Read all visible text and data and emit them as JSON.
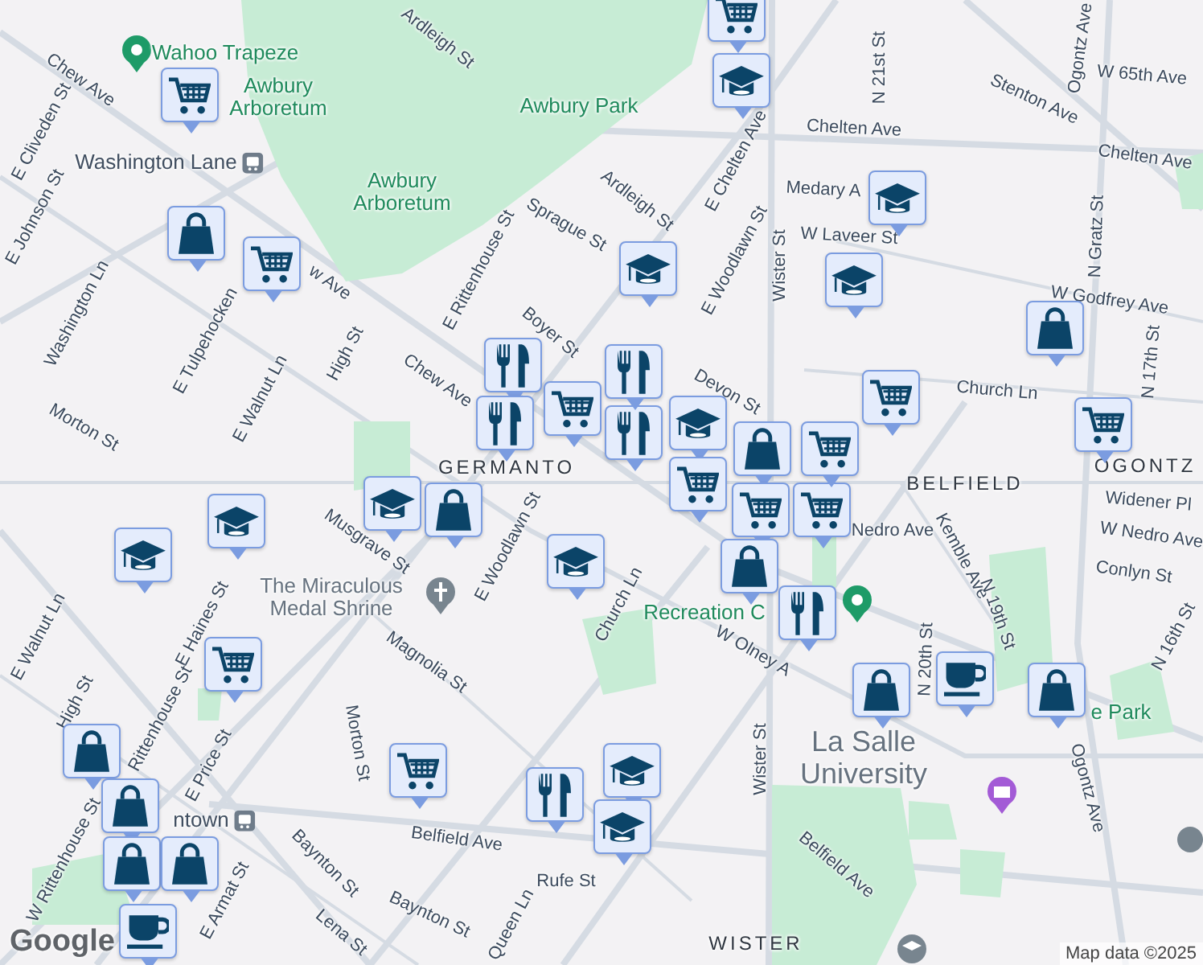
{
  "map": {
    "labels": [
      {
        "text": "Ardleigh St",
        "kind": "street"
      },
      {
        "text": "Chew Ave",
        "kind": "street"
      },
      {
        "text": "E Cliveden St",
        "kind": "street"
      },
      {
        "text": "E Johnson St",
        "kind": "street"
      },
      {
        "text": "Washington Ln",
        "kind": "street"
      },
      {
        "text": "E Tulpehocken",
        "kind": "street"
      },
      {
        "text": "w Ave",
        "kind": "street"
      },
      {
        "text": "E Walnut Ln",
        "kind": "street"
      },
      {
        "text": "High St",
        "kind": "street"
      },
      {
        "text": "Chew Ave",
        "kind": "street"
      },
      {
        "text": "E Rittenhouse St",
        "kind": "street"
      },
      {
        "text": "Boyer St",
        "kind": "street"
      },
      {
        "text": "Morton St",
        "kind": "street"
      },
      {
        "text": "Sprague St",
        "kind": "street"
      },
      {
        "text": "Ardleigh St",
        "kind": "street"
      },
      {
        "text": "E Chelten Ave",
        "kind": "street"
      },
      {
        "text": "E Woodlawn St",
        "kind": "street"
      },
      {
        "text": "Wister St",
        "kind": "street"
      },
      {
        "text": "N 21st St",
        "kind": "street"
      },
      {
        "text": "Chelten Ave",
        "kind": "street"
      },
      {
        "text": "Stenton Ave",
        "kind": "street"
      },
      {
        "text": "Ogontz Ave",
        "kind": "street"
      },
      {
        "text": "W 65th Ave",
        "kind": "street"
      },
      {
        "text": "Chelten Ave",
        "kind": "street"
      },
      {
        "text": "Medary A",
        "kind": "street"
      },
      {
        "text": "W Laveer St",
        "kind": "street"
      },
      {
        "text": "W Godfrey Ave",
        "kind": "street"
      },
      {
        "text": "N Gratz St",
        "kind": "street"
      },
      {
        "text": "N 17th St",
        "kind": "street"
      },
      {
        "text": "Devon St",
        "kind": "street"
      },
      {
        "text": "Church Ln",
        "kind": "street"
      },
      {
        "text": "Nedro Ave",
        "kind": "street"
      },
      {
        "text": "Widener Pl",
        "kind": "street"
      },
      {
        "text": "W Nedro Ave",
        "kind": "street"
      },
      {
        "text": "Conlyn St",
        "kind": "street"
      },
      {
        "text": "Kemble Ave",
        "kind": "street"
      },
      {
        "text": "N 19th St",
        "kind": "street"
      },
      {
        "text": "N 20th St",
        "kind": "street"
      },
      {
        "text": "N 16th St",
        "kind": "street"
      },
      {
        "text": "W Olney A",
        "kind": "street"
      },
      {
        "text": "Ogontz Ave",
        "kind": "street"
      },
      {
        "text": "Wister St",
        "kind": "street"
      },
      {
        "text": "Belfield Ave",
        "kind": "street"
      },
      {
        "text": "Musgrave St",
        "kind": "street"
      },
      {
        "text": "E Woodlawn St",
        "kind": "street"
      },
      {
        "text": "Church Ln",
        "kind": "street"
      },
      {
        "text": "High St",
        "kind": "street"
      },
      {
        "text": "E Haines St",
        "kind": "street"
      },
      {
        "text": "E Walnut Ln",
        "kind": "street"
      },
      {
        "text": "Magnolia St",
        "kind": "street"
      },
      {
        "text": "Morton St",
        "kind": "street"
      },
      {
        "text": "Baynton St",
        "kind": "street"
      },
      {
        "text": "Belfield Ave",
        "kind": "street"
      },
      {
        "text": "Baynton St",
        "kind": "street"
      },
      {
        "text": "Rufe St",
        "kind": "street"
      },
      {
        "text": "E Price St",
        "kind": "street"
      },
      {
        "text": "E Armat St",
        "kind": "street"
      },
      {
        "text": "Lena St",
        "kind": "street"
      },
      {
        "text": "Queen Ln",
        "kind": "street"
      },
      {
        "text": "Rittenhouse St",
        "kind": "street"
      },
      {
        "text": "W Rittenhouse St",
        "kind": "street"
      },
      {
        "text": "Wahoo Trapeze",
        "kind": "poi"
      },
      {
        "text": "Awbury Arboretum",
        "kind": "park"
      },
      {
        "text": "Washington Lane",
        "kind": "station"
      },
      {
        "text": "Awbury Park",
        "kind": "park"
      },
      {
        "text": "Awbury Arboretum",
        "kind": "park"
      },
      {
        "text": "The Miraculous Medal Shrine",
        "kind": "place"
      },
      {
        "text": "GERMANTO",
        "kind": "district"
      },
      {
        "text": "BELFIELD",
        "kind": "district"
      },
      {
        "text": "OGONTZ",
        "kind": "district"
      },
      {
        "text": "Recreation C",
        "kind": "park"
      },
      {
        "text": "La Salle University",
        "kind": "university"
      },
      {
        "text": "ntown",
        "kind": "station"
      },
      {
        "text": "WISTER",
        "kind": "district"
      },
      {
        "text": "e Park",
        "kind": "park"
      }
    ],
    "markers": [
      {
        "kind": "grocery"
      },
      {
        "kind": "school"
      },
      {
        "kind": "grocery"
      },
      {
        "kind": "shopping"
      },
      {
        "kind": "grocery"
      },
      {
        "kind": "school"
      },
      {
        "kind": "school"
      },
      {
        "kind": "school"
      },
      {
        "kind": "shopping"
      },
      {
        "kind": "grocery"
      },
      {
        "kind": "grocery"
      },
      {
        "kind": "restaurant"
      },
      {
        "kind": "restaurant"
      },
      {
        "kind": "grocery"
      },
      {
        "kind": "restaurant"
      },
      {
        "kind": "school"
      },
      {
        "kind": "grocery"
      },
      {
        "kind": "shopping"
      },
      {
        "kind": "grocery"
      },
      {
        "kind": "grocery"
      },
      {
        "kind": "grocery"
      },
      {
        "kind": "school"
      },
      {
        "kind": "shopping"
      },
      {
        "kind": "school"
      },
      {
        "kind": "school"
      },
      {
        "kind": "school"
      },
      {
        "kind": "shopping"
      },
      {
        "kind": "restaurant"
      },
      {
        "kind": "grocery"
      },
      {
        "kind": "shopping"
      },
      {
        "kind": "cafe"
      },
      {
        "kind": "shopping"
      },
      {
        "kind": "grocery"
      },
      {
        "kind": "restaurant"
      },
      {
        "kind": "school"
      },
      {
        "kind": "school"
      },
      {
        "kind": "shopping"
      },
      {
        "kind": "shopping"
      },
      {
        "kind": "shopping"
      },
      {
        "kind": "shopping"
      },
      {
        "kind": "cafe"
      },
      {
        "kind": "restaurant"
      }
    ]
  },
  "attribution": {
    "logo": "Google",
    "text": "Map data ©2025"
  }
}
